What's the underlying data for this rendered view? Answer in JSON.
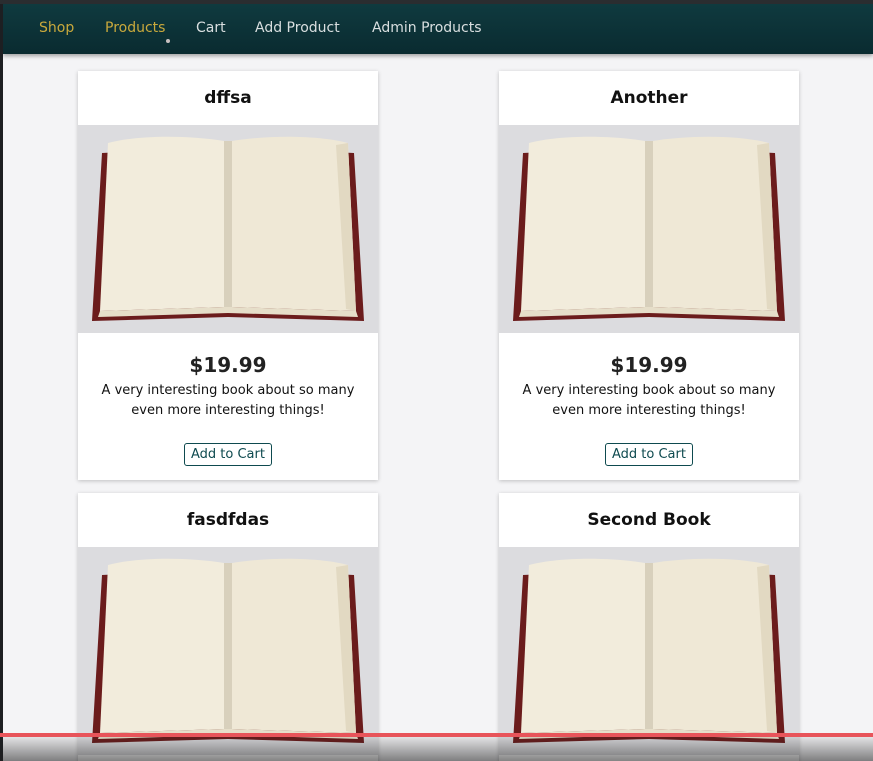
{
  "nav": {
    "items": [
      {
        "label": "Shop"
      },
      {
        "label": "Products"
      },
      {
        "label": "Cart"
      },
      {
        "label": "Add Product"
      },
      {
        "label": "Admin Products"
      }
    ]
  },
  "products": [
    {
      "title": "dffsa",
      "price": "$19.99",
      "description": "A very interesting book about so many even more interesting things!",
      "button": "Add to Cart",
      "image": "open-book-image"
    },
    {
      "title": "Another",
      "price": "$19.99",
      "description": "A very interesting book about so many even more interesting things!",
      "button": "Add to Cart",
      "image": "open-book-image"
    },
    {
      "title": "fasdfdas",
      "image": "open-book-image"
    },
    {
      "title": "Second Book",
      "image": "open-book-image"
    }
  ],
  "video": {
    "progress_fraction": 1.0,
    "progress_color": "#e8545a"
  },
  "colors": {
    "navbar": "#0f3a3f",
    "active_nav": "#c9a93c",
    "button_border": "#0e4a4f"
  }
}
